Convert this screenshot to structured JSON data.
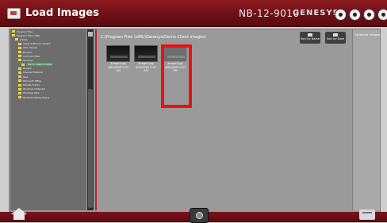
{
  "window": {
    "title": "Load Images",
    "model": "NB-12-9010",
    "brand": "GENESYS"
  },
  "path_bar": {
    "text": "C:\\Program Files (x86)\\Genesys\\Demo Client Images\\"
  },
  "toolbar": {
    "sort_by_name": "Sort by Name",
    "sort_by_date": "Sort by Date"
  },
  "selected_panel": {
    "title": "Selected Images"
  },
  "thumbnails": [
    {
      "name": "Image1.jpg",
      "date": "4/20/2009 9:07 AM"
    },
    {
      "name": "Image2.jpg",
      "date": "4/20/2009 9:07 AM"
    },
    {
      "name": "Image3.jpg",
      "date": "4/20/2009 9:07 PM"
    }
  ],
  "tree": {
    "items": [
      {
        "label": "Program Files"
      },
      {
        "label": "Program Files (x86)"
      },
      {
        "label": "Adobe"
      },
      {
        "label": "Apple Software Update"
      },
      {
        "label": "AVG Tuneup"
      },
      {
        "label": "Bonjour"
      },
      {
        "label": "Common Files"
      },
      {
        "label": "Genesys"
      },
      {
        "label": "Demo Client Images"
      },
      {
        "label": "Google"
      },
      {
        "label": "Internet Explorer"
      },
      {
        "label": "Java"
      },
      {
        "label": "Microsoft Office"
      },
      {
        "label": "Mozilla Firefox"
      },
      {
        "label": "Windows Defender"
      },
      {
        "label": "Windows Mail"
      },
      {
        "label": "Windows Media Player"
      }
    ]
  }
}
